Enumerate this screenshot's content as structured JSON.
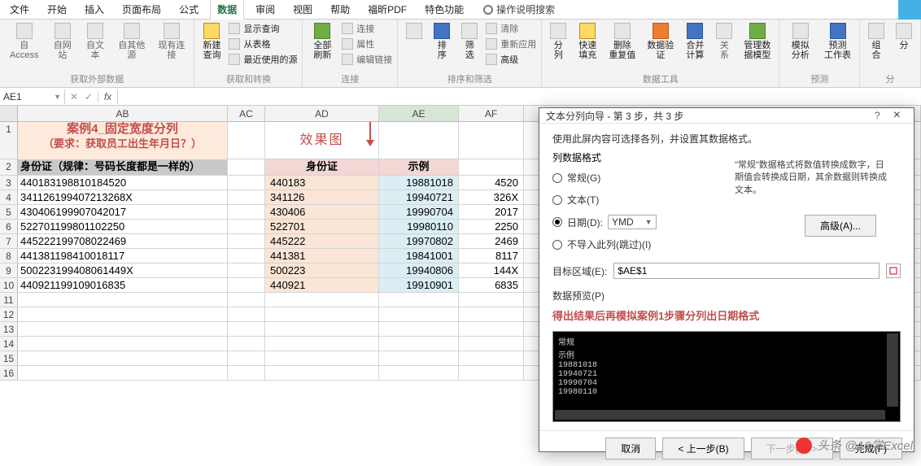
{
  "tabs": {
    "items": [
      "文件",
      "开始",
      "插入",
      "页面布局",
      "公式",
      "数据",
      "审阅",
      "视图",
      "帮助",
      "福昕PDF",
      "特色功能"
    ],
    "active_index": 5,
    "tell_me": "操作说明搜索"
  },
  "ribbon": {
    "g1": {
      "b1": "自 Access",
      "b2": "自网站",
      "b3": "自文本",
      "b4": "自其他源",
      "b5": "现有连接",
      "title": "获取外部数据"
    },
    "g2": {
      "big": "新建\n查询",
      "s1": "显示查询",
      "s2": "从表格",
      "s3": "最近使用的源",
      "title": "获取和转换"
    },
    "g3": {
      "big": "全部刷新",
      "s1": "连接",
      "s2": "属性",
      "s3": "编辑链接",
      "title": "连接"
    },
    "g4": {
      "b1": "排序",
      "b2": "筛选",
      "s1": "清除",
      "s2": "重新应用",
      "s3": "高级",
      "title": "排序和筛选"
    },
    "g5": {
      "b1": "分列",
      "b2": "快速填充",
      "b3": "删除\n重复值",
      "b4": "数据验\n证",
      "b5": "合并计算",
      "b6": "关系",
      "b7": "管理数\n据模型",
      "title": "数据工具"
    },
    "g6": {
      "b1": "模拟分析",
      "b2": "预测\n工作表",
      "title": "预测"
    },
    "g7": {
      "b1": "组合",
      "b2": "分",
      "title": "分"
    }
  },
  "name_box": "AE1",
  "columns": [
    "AB",
    "AC",
    "AD",
    "AE",
    "AF"
  ],
  "title_cell": "案例4_固定宽度分列",
  "subtitle_cell": "（要求：获取员工出生年月日？）",
  "effect_label": "效果图",
  "header_ab": "身份证（规律：号码长度都是一样的）",
  "header_ad": "身份证",
  "header_ae": "示例",
  "rows": [
    {
      "n": "3",
      "ab": "440183198810184520",
      "ad": "440183",
      "ae": "19881018",
      "af": "4520"
    },
    {
      "n": "4",
      "ab": "341126199407213268X",
      "ad": "341126",
      "ae": "19940721",
      "af": "326X"
    },
    {
      "n": "5",
      "ab": "430406199907042017",
      "ad": "430406",
      "ae": "19990704",
      "af": "2017"
    },
    {
      "n": "6",
      "ab": "522701199801102250",
      "ad": "522701",
      "ae": "19980110",
      "af": "2250"
    },
    {
      "n": "7",
      "ab": "445222199708022469",
      "ad": "445222",
      "ae": "19970802",
      "af": "2469"
    },
    {
      "n": "8",
      "ab": "441381198410018117",
      "ad": "441381",
      "ae": "19841001",
      "af": "8117"
    },
    {
      "n": "9",
      "ab": "500223199408061449X",
      "ad": "500223",
      "ae": "19940806",
      "af": "144X"
    },
    {
      "n": "10",
      "ab": "440921199109016835",
      "ad": "440921",
      "ae": "19910901",
      "af": "6835"
    }
  ],
  "empty_rows": [
    "11",
    "12",
    "13",
    "14",
    "15",
    "16"
  ],
  "dialog": {
    "title": "文本分列向导 - 第 3 步，共 3 步",
    "desc": "使用此屏内容可选择各列，并设置其数据格式。",
    "section_label": "列数据格式",
    "opt_general": "常规(G)",
    "opt_text": "文本(T)",
    "opt_date": "日期(D):",
    "opt_skip": "不导入此列(跳过)(I)",
    "date_fmt": "YMD",
    "info_text": "\"常规\"数据格式将数值转换成数字，日期值会转换成日期，其余数据则转换成文本。",
    "advanced_btn": "高级(A)...",
    "dest_label": "目标区域(E):",
    "dest_value": "$AE$1",
    "preview_label": "数据预览(P)",
    "preview_title": "得出结果后再模拟案例1步骤分列出日期格式",
    "preview_lines": [
      "常规",
      "示例",
      "19881018",
      "19940721",
      "19990704",
      "19980110"
    ],
    "btn_cancel": "取消",
    "btn_back": "< 上一步(B)",
    "btn_next": "下一步(N) >",
    "btn_finish": "完成(F)"
  },
  "watermark": "头条 @16学Excel"
}
